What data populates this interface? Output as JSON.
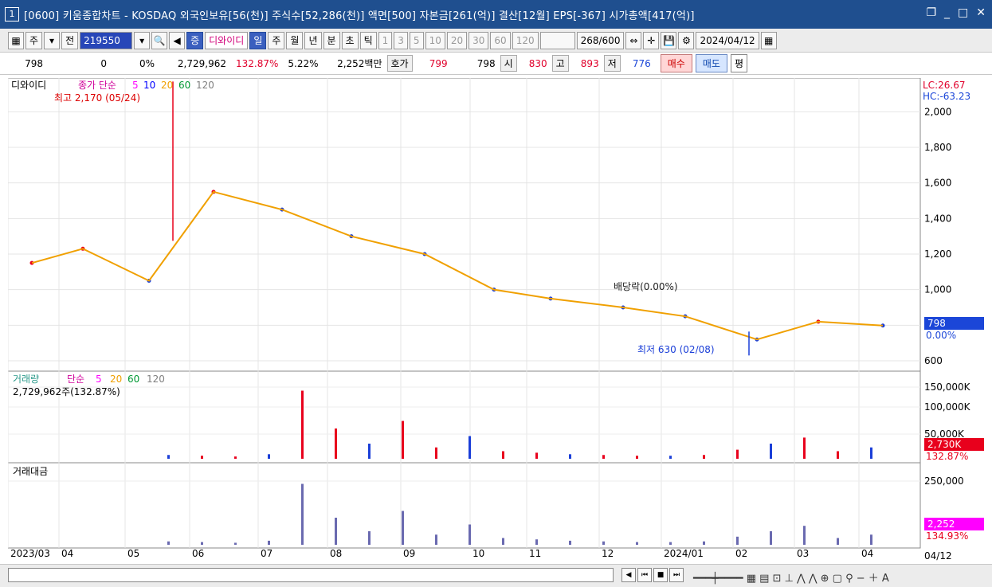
{
  "window": {
    "number": "1",
    "title": "[0600] 키움종합차트 - KOSDAQ 외국인보유[56(천)] 주식수[52,286(천)] 액면[500] 자본금[261(억)] 결산[12월] EPS[-367] 시가총액[417(억)]",
    "controls": [
      "▭",
      "_",
      "❐",
      "✕"
    ]
  },
  "toolbar": {
    "stock_type": "주",
    "prev_label": "전",
    "code": "219550",
    "search_icon": "search-icon",
    "badge": "증",
    "name": "디와이디",
    "period_active": "일",
    "periods": [
      "일",
      "주",
      "월",
      "년",
      "분",
      "초",
      "틱"
    ],
    "intervals": [
      "1",
      "3",
      "5",
      "10",
      "20",
      "30",
      "60",
      "120"
    ],
    "count": "268",
    "count_total": "/600",
    "date": "2024/04/12"
  },
  "quote": {
    "price": "798",
    "change": "0",
    "change_pct": "0%",
    "volume": "2,729,962",
    "vol_ratio": "132.87%",
    "turnover": "5.22%",
    "amount": "2,252백만",
    "hoga_label": "호가",
    "ask": "799",
    "bid": "798",
    "open_label": "시",
    "open": "830",
    "high_label": "고",
    "high": "893",
    "low_label": "저",
    "low": "776",
    "buy_label": "매수",
    "sell_label": "매도",
    "eval_label": "평"
  },
  "price_panel": {
    "stock_name": "디와이디",
    "ma_title": "종가 단순",
    "ma_periods": [
      "5",
      "10",
      "20",
      "60",
      "120"
    ],
    "ma_colors": [
      "#ff00ff",
      "#0000ff",
      "#f0a000",
      "#009933",
      "#808080"
    ],
    "max_label": "최고 2,170 (05/24)",
    "min_label": "최저 630 (02/08)",
    "dividend_label": "배당락(0.00%)",
    "lc": "LC:26.67",
    "hc": "HC:-63.23",
    "current_price": "798",
    "current_pct": "0.00%",
    "y_ticks": [
      "2,000",
      "1,800",
      "1,600",
      "1,400",
      "1,200",
      "1,000",
      "800",
      "600"
    ]
  },
  "volume_panel": {
    "title": "거래량",
    "ma_title": "단순",
    "ma_periods": [
      "5",
      "20",
      "60",
      "120"
    ],
    "current": "2,729,962주(132.87%)",
    "y_ticks": [
      "150,000K",
      "100,000K",
      "50,000K"
    ],
    "last_value": "2,730K",
    "last_pct": "132.87%"
  },
  "amount_panel": {
    "title": "거래대금",
    "y_ticks": [
      "250,000"
    ],
    "last_value": "2,252",
    "last_pct": "134.93%"
  },
  "x_axis": {
    "labels": [
      "2023/03",
      "04",
      "05",
      "06",
      "07",
      "08",
      "09",
      "10",
      "11",
      "12",
      "2024/01",
      "02",
      "03",
      "04"
    ],
    "last_date": "04/12"
  },
  "colors": {
    "up": "#e8001c",
    "down": "#1b3fd8",
    "ma5": "#ff00ff",
    "ma10": "#0000ff",
    "ma20": "#f0a000",
    "ma60": "#009933",
    "ma120": "#808080",
    "title_bg": "#1f4f8f"
  },
  "chart_data": {
    "type": "line",
    "title": "디와이디",
    "series": [
      {
        "name": "종가",
        "x": [
          "2023/03",
          "2023/04",
          "2023/05",
          "2023/06",
          "2023/07",
          "2023/08",
          "2023/09",
          "2023/10",
          "2023/11",
          "2023/12",
          "2024/01",
          "2024/02",
          "2024/03",
          "2024/04"
        ],
        "values": [
          1150,
          1230,
          1050,
          1550,
          1450,
          1300,
          1200,
          1000,
          950,
          900,
          850,
          720,
          820,
          798
        ]
      }
    ],
    "events": [
      {
        "label": "최고 2,170 (05/24)",
        "date": "05/24",
        "value": 2170
      },
      {
        "label": "최저 630 (02/08)",
        "date": "02/08",
        "value": 630
      }
    ],
    "ylim": [
      600,
      2100
    ]
  }
}
